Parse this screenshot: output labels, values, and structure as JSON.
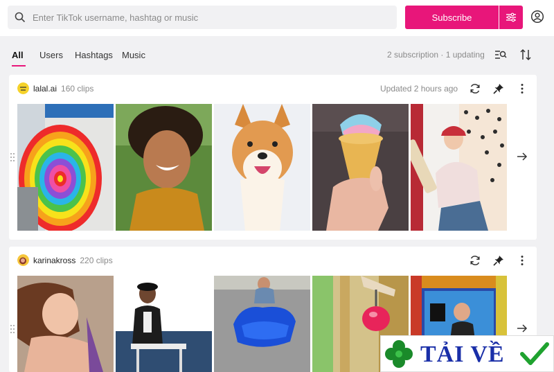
{
  "search": {
    "placeholder": "Enter TikTok username, hashtag or music"
  },
  "header": {
    "subscribe_label": "Subscribe"
  },
  "tabs": [
    {
      "label": "All",
      "active": true
    },
    {
      "label": "Users",
      "active": false
    },
    {
      "label": "Hashtags",
      "active": false
    },
    {
      "label": "Music",
      "active": false
    }
  ],
  "subscription_status": "2 subscription · 1 updating",
  "feeds": [
    {
      "username": "lalal.ai",
      "clips": "160 clips",
      "updated": "Updated 2 hours ago",
      "thumbnails": [
        "rainbow spiral wall",
        "laughing woman",
        "shiba dog",
        "ice cream cone",
        "girl with cricket bat"
      ]
    },
    {
      "username": "karinakross",
      "clips": "220 clips",
      "updated": "",
      "thumbnails": [
        "woman portrait",
        "man with table",
        "blue tarp",
        "pink ball",
        "studio stage"
      ]
    }
  ],
  "overlay": {
    "text": "TẢI VỀ"
  },
  "colors": {
    "accent": "#e8167a",
    "background": "#f1f1f3"
  }
}
